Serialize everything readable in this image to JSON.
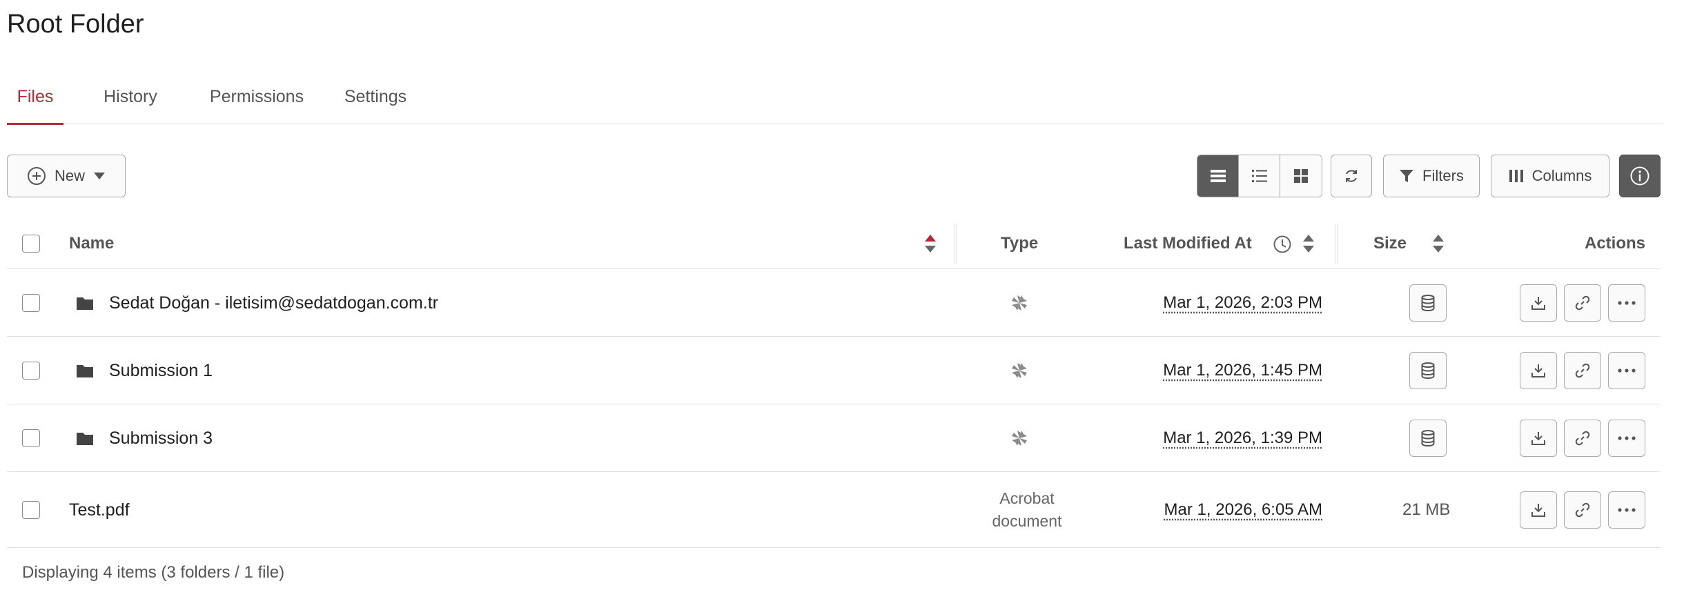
{
  "page": {
    "title": "Root Folder"
  },
  "tabs": [
    {
      "label": "Files",
      "active": true
    },
    {
      "label": "History",
      "active": false
    },
    {
      "label": "Permissions",
      "active": false
    },
    {
      "label": "Settings",
      "active": false
    }
  ],
  "toolbar": {
    "new_label": "New",
    "filters_label": "Filters",
    "columns_label": "Columns",
    "view_modes": [
      "table-view-icon",
      "list-view-icon",
      "grid-view-icon"
    ],
    "active_view": "table-view-icon"
  },
  "table": {
    "headers": {
      "name": "Name",
      "type": "Type",
      "modified": "Last Modified At",
      "size": "Size",
      "actions": "Actions"
    },
    "rows": [
      {
        "name": "Sedat Doğan - iletisim@sedatdogan.com.tr",
        "kind": "folder",
        "type": "",
        "modified": "Mar 1, 2026, 2:03 PM",
        "size": ""
      },
      {
        "name": "Submission 1",
        "kind": "folder",
        "type": "",
        "modified": "Mar 1, 2026, 1:45 PM",
        "size": ""
      },
      {
        "name": "Submission 3",
        "kind": "folder",
        "type": "",
        "modified": "Mar 1, 2026, 1:39 PM",
        "size": ""
      },
      {
        "name": "Test.pdf",
        "kind": "file",
        "type_line1": "Acrobat",
        "type_line2": "document",
        "modified": "Mar 1, 2026, 6:05 AM",
        "size": "21 MB"
      }
    ]
  },
  "footer": {
    "text": "Displaying 4 items (3 folders / 1 file)"
  },
  "colors": {
    "accent": "#b02a37",
    "dark_button": "#5b5b5b",
    "border": "#a9a9a9"
  }
}
